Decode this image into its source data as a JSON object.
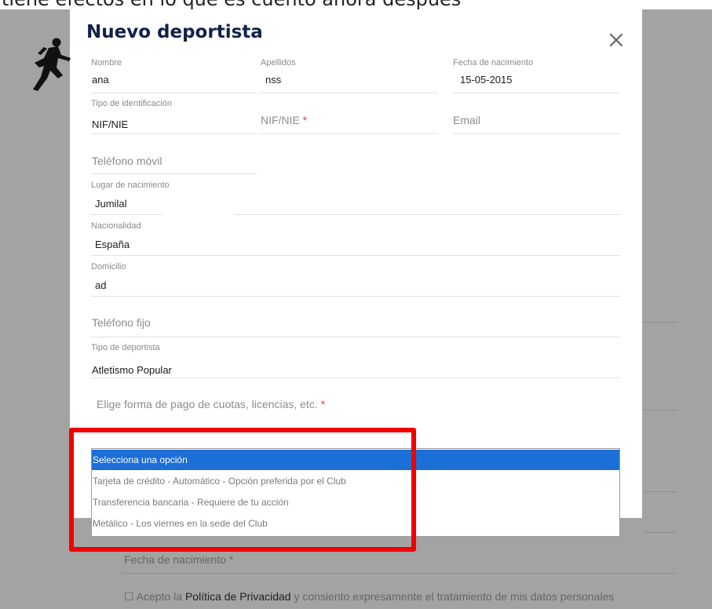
{
  "background": {
    "heading": "tiene efectos en lo que es cuento ahora después",
    "birthdate_label": "Fecha de nacimiento",
    "required_mark": "*",
    "privacy_checkbox": "☐",
    "privacy_prefix": "Acepto la",
    "privacy_link": "Política de Privacidad",
    "privacy_suffix": "y consiento expresamente el tratamiento de mis datos personales"
  },
  "modal": {
    "title": "Nuevo deportista",
    "close_glyph": "✕",
    "fields": {
      "nombre": {
        "label": "Nombre",
        "value": "ana"
      },
      "apellidos": {
        "label": "Apellidos",
        "value": "nss"
      },
      "fecha_nacimiento": {
        "label": "Fecha de nacimiento",
        "value": "15-05-2015"
      },
      "tipo_identificacion": {
        "label": "Tipo de identificación",
        "value": "NIF/NIE"
      },
      "nif_nie": {
        "placeholder": "NIF/NIE",
        "required_mark": "*"
      },
      "email": {
        "placeholder": "Email"
      },
      "telefono_movil": {
        "placeholder": "Teléfono móvil"
      },
      "lugar_nacimiento": {
        "label": "Lugar de nacimiento",
        "value": "Jumilal"
      },
      "nacionalidad": {
        "label": "Nacionalidad",
        "value": "España"
      },
      "domicilio": {
        "label": "Domicilio",
        "value": "ad"
      },
      "telefono_fijo": {
        "placeholder": "Teléfono fijo"
      },
      "tipo_deportista": {
        "label": "Tipo de deportista",
        "value": "Atletismo Popular"
      },
      "forma_pago": {
        "placeholder": "Elige forma de pago de cuotas, licencias, etc.",
        "required_mark": "*"
      }
    },
    "payment_options": [
      {
        "label": "Selecciona una opción",
        "selected": true
      },
      {
        "label": "Tarjeta de crédito - Automático - Opción preferida por el Club",
        "selected": false
      },
      {
        "label": "Transferencia bancaria - Requiere de tu acción",
        "selected": false
      },
      {
        "label": "Metálico - Los viernes en la sede del Club",
        "selected": false
      }
    ]
  },
  "colors": {
    "title": "#10224a",
    "selected_option": "#1c6fd6",
    "highlight": "#f10000",
    "overlay": "#a3a3a3"
  },
  "icons": {
    "logo": "runner-silhouette-icon",
    "close": "close-icon"
  }
}
